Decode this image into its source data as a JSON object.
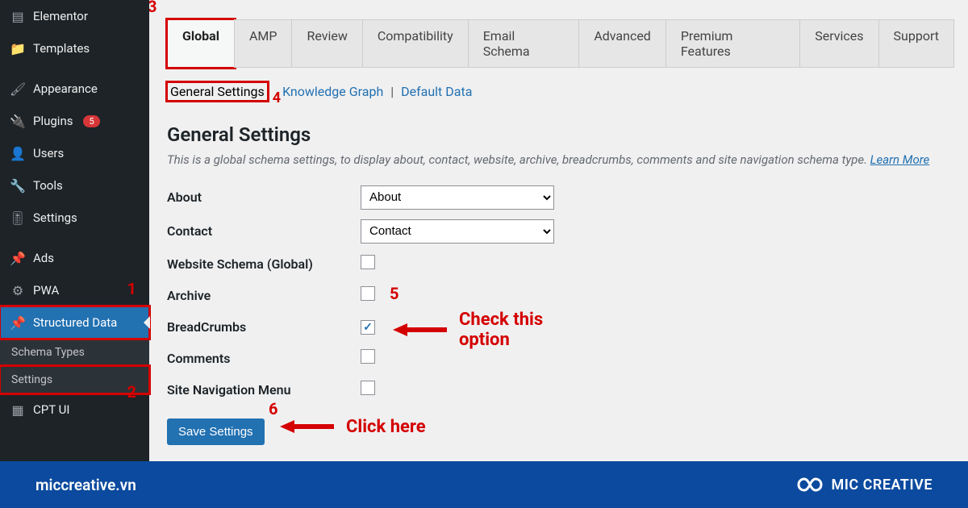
{
  "sidebar": {
    "items": [
      {
        "label": "Elementor"
      },
      {
        "label": "Templates"
      },
      {
        "label": "Appearance"
      },
      {
        "label": "Plugins",
        "badge": "5"
      },
      {
        "label": "Users"
      },
      {
        "label": "Tools"
      },
      {
        "label": "Settings"
      },
      {
        "label": "Ads"
      },
      {
        "label": "PWA"
      },
      {
        "label": "Structured Data"
      },
      {
        "label": "CPT UI"
      }
    ],
    "sub": [
      {
        "label": "Schema Types"
      },
      {
        "label": "Settings"
      }
    ]
  },
  "tabs": [
    "Global",
    "AMP",
    "Review",
    "Compatibility",
    "Email Schema",
    "Advanced",
    "Premium Features",
    "Services",
    "Support"
  ],
  "subtabs": {
    "current": "General Settings",
    "links": [
      "Knowledge Graph",
      "Default Data"
    ]
  },
  "section": {
    "title": "General Settings",
    "desc": "This is a global schema settings, to display about, contact, website, archive, breadcrumbs, comments and site navigation schema type. ",
    "learn": "Learn More"
  },
  "fields": {
    "about": {
      "label": "About",
      "value": "About"
    },
    "contact": {
      "label": "Contact",
      "value": "Contact"
    },
    "website": {
      "label": "Website Schema (Global)",
      "checked": false
    },
    "archive": {
      "label": "Archive",
      "checked": false
    },
    "breadcrumbs": {
      "label": "BreadCrumbs",
      "checked": true
    },
    "comments": {
      "label": "Comments",
      "checked": false
    },
    "sitenav": {
      "label": "Site Navigation Menu",
      "checked": false
    }
  },
  "button": {
    "save": "Save Settings"
  },
  "annotations": {
    "n1": "1",
    "n2": "2",
    "n3": "3",
    "n4": "4",
    "n5": "5",
    "n6": "6",
    "check_text": "Check this option",
    "click_text": "Click here"
  },
  "footer": {
    "site": "miccreative.vn",
    "brand": "MIC CREATIVE"
  }
}
